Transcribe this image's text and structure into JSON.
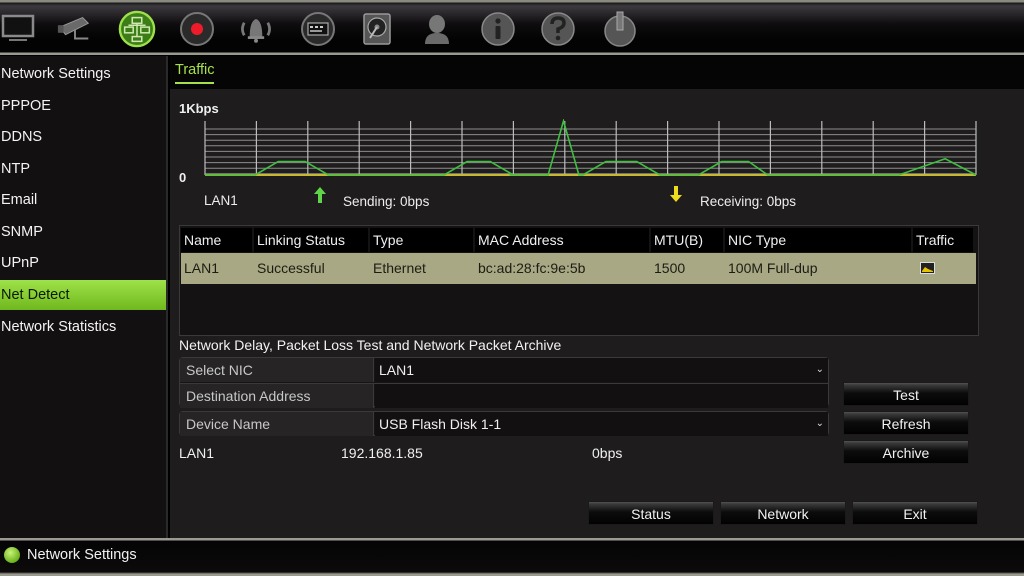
{
  "toolbar": {
    "icons": [
      {
        "name": "display-icon",
        "active": false
      },
      {
        "name": "camera-icon",
        "active": false
      },
      {
        "name": "network-icon",
        "active": true
      },
      {
        "name": "record-icon",
        "active": false
      },
      {
        "name": "alarm-icon",
        "active": false
      },
      {
        "name": "device-icon",
        "active": false
      },
      {
        "name": "storage-icon",
        "active": false
      },
      {
        "name": "user-icon",
        "active": false
      },
      {
        "name": "info-icon",
        "active": false
      },
      {
        "name": "help-icon",
        "active": false
      },
      {
        "name": "power-icon",
        "active": false
      }
    ]
  },
  "sidebar": {
    "items": [
      {
        "label": "Network Settings",
        "active": false
      },
      {
        "label": "PPPOE",
        "active": false
      },
      {
        "label": "DDNS",
        "active": false
      },
      {
        "label": "NTP",
        "active": false
      },
      {
        "label": "Email",
        "active": false
      },
      {
        "label": "SNMP",
        "active": false
      },
      {
        "label": "UPnP",
        "active": false
      },
      {
        "label": "Net Detect",
        "active": true
      },
      {
        "label": "Network Statistics",
        "active": false
      }
    ]
  },
  "tabs": [
    {
      "label": "Traffic",
      "active": true
    }
  ],
  "traffic": {
    "y_max_label": "1Kbps",
    "y_min_label": "0",
    "interface": "LAN1",
    "sending_label": "Sending: 0bps",
    "receiving_label": "Receiving: 0bps",
    "colors": {
      "line": "#3fbf3f",
      "baseline": "#c8b830",
      "grid": "#bdbdbd",
      "send_arrow": "#5fd64a",
      "recv_arrow": "#f0dc1e"
    }
  },
  "chart_data": {
    "type": "line",
    "title": "Traffic",
    "ylabel": "",
    "ylim": [
      0,
      1
    ],
    "y_tick_labels": [
      "0",
      "1Kbps"
    ],
    "x_range": [
      0,
      100
    ],
    "grid": true,
    "series": [
      {
        "name": "LAN1 traffic",
        "points": [
          [
            0,
            0
          ],
          [
            6.5,
            0
          ],
          [
            9.5,
            0.25
          ],
          [
            13,
            0.25
          ],
          [
            16,
            0
          ],
          [
            31,
            0
          ],
          [
            34,
            0.25
          ],
          [
            37,
            0.25
          ],
          [
            40,
            0
          ],
          [
            39.5,
            0
          ],
          [
            40.5,
            0
          ],
          [
            44.5,
            0
          ],
          [
            46.5,
            1.0
          ],
          [
            48.5,
            0
          ],
          [
            49,
            0
          ],
          [
            52,
            0.25
          ],
          [
            56,
            0.25
          ],
          [
            59,
            0
          ],
          [
            64,
            0
          ],
          [
            67,
            0.25
          ],
          [
            70.5,
            0.25
          ],
          [
            73,
            0
          ],
          [
            90,
            0
          ],
          [
            96,
            0.3
          ],
          [
            100,
            0
          ]
        ]
      }
    ]
  },
  "nic_table": {
    "columns": [
      "Name",
      "Linking Status",
      "Type",
      "MAC Address",
      "MTU(B)",
      "NIC Type",
      "Traffic"
    ],
    "rows": [
      {
        "name": "LAN1",
        "linking_status": "Successful",
        "type": "Ethernet",
        "mac": "bc:ad:28:fc:9e:5b",
        "mtu": "1500",
        "nic_type": "100M Full-dup",
        "traffic": "traffic-chart-icon"
      }
    ]
  },
  "test_section": {
    "title": "Network Delay, Packet Loss Test and Network Packet Archive",
    "select_nic_label": "Select NIC",
    "select_nic_value": "LAN1",
    "destination_label": "Destination Address",
    "destination_value": "",
    "device_name_label": "Device Name",
    "device_name_value": "USB Flash Disk 1-1",
    "test_button": "Test",
    "refresh_button": "Refresh",
    "archive_button": "Archive",
    "info_nic": "LAN1",
    "info_ip": "192.168.1.85",
    "info_rate": "0bps"
  },
  "footer_buttons": {
    "status": "Status",
    "network": "Network",
    "exit": "Exit"
  },
  "statusbar": {
    "text": "Network Settings"
  }
}
